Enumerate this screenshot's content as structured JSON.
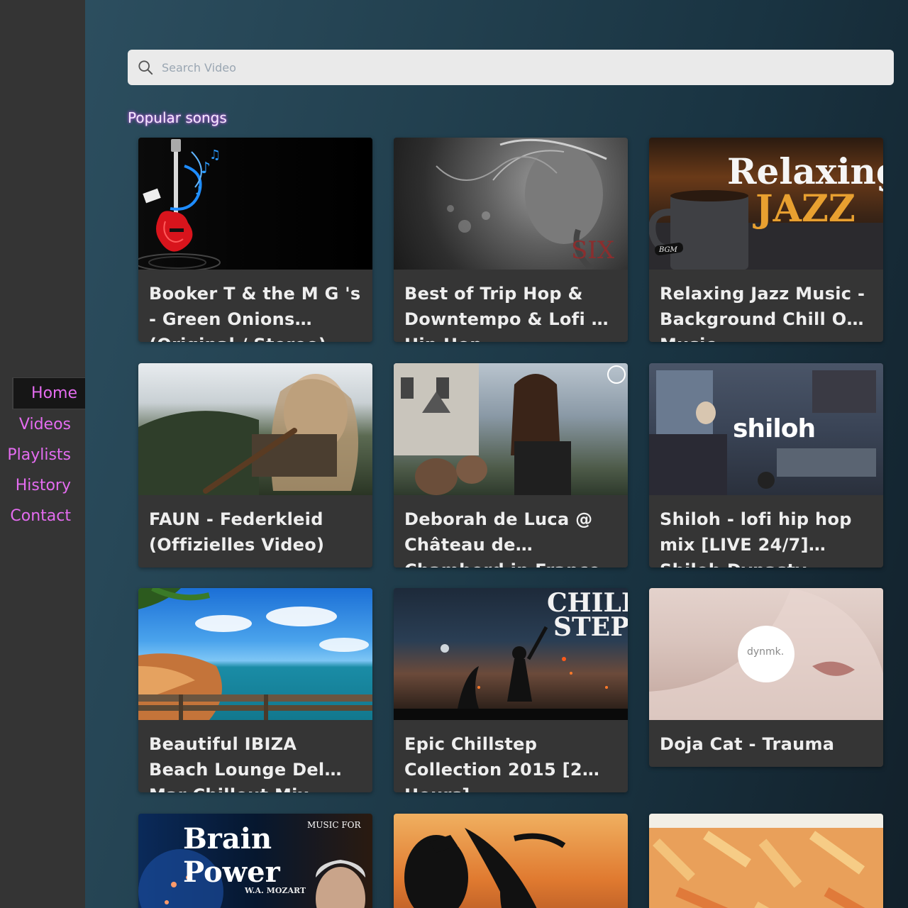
{
  "sidebar": {
    "items": [
      {
        "label": "Home",
        "active": true
      },
      {
        "label": "Videos"
      },
      {
        "label": "Playlists"
      },
      {
        "label": "History"
      },
      {
        "label": "Contact"
      }
    ]
  },
  "search": {
    "placeholder": "Search Video",
    "icon": "search-icon"
  },
  "section": {
    "title": "Popular songs"
  },
  "videos": [
    {
      "title": "Booker T & the M G 's - Green Onions (Original / Stereo)"
    },
    {
      "title": "Best of Trip Hop & Downtempo & Lofi & Hip Hop"
    },
    {
      "title": "Relaxing Jazz Music - Background Chill Out Music"
    },
    {
      "title": "FAUN - Federkleid (Offizielles Video)"
    },
    {
      "title": "Deborah de Luca @ Château de Chambord in France"
    },
    {
      "title": "Shiloh - lofi hip hop mix [LIVE 24/7] Shiloh Dynasty"
    },
    {
      "title": "Beautiful IBIZA Beach Lounge Del Mar Chillout Mix"
    },
    {
      "title": "Epic Chillstep Collection 2015 [2 Hours]"
    },
    {
      "title": "Doja Cat - Trauma"
    }
  ],
  "thumb_text": {
    "jazz_line1": "Relaxing",
    "jazz_line2": "JAZZ",
    "jazz_badge": "BGM",
    "shiloh": "shiloh",
    "chill_line1": "CHILL",
    "chill_line2": "STEP",
    "dynmk": "dynmk.",
    "brain_small": "MUSIC FOR",
    "brain_big": "Brain Power",
    "brain_author": "W.A. MOZART",
    "six": "SIX"
  },
  "colors": {
    "nav_text": "#e46cf0",
    "sidebar_bg": "#343434",
    "card_bg": "#353535",
    "search_bg": "#eaeaea"
  }
}
